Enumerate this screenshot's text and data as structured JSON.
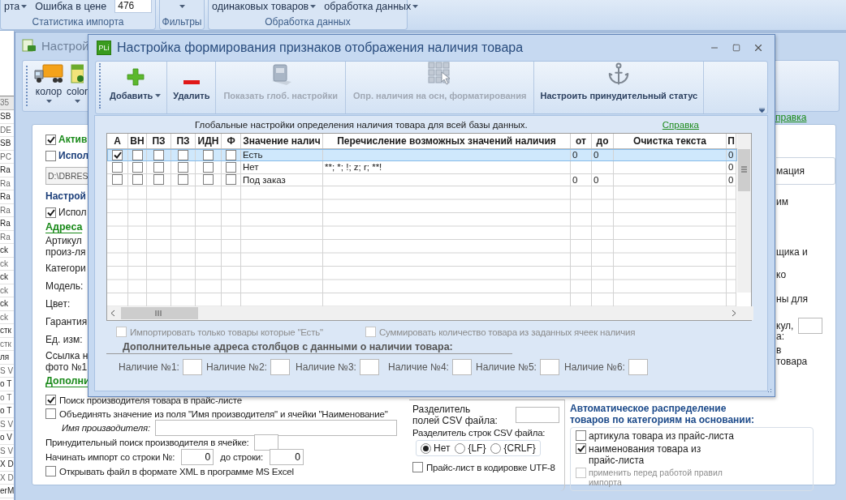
{
  "ribbon": {
    "groups": [
      {
        "caption": "Статистика импорта",
        "items": [
          {
            "kind": "dropdown",
            "label": "рта"
          },
          {
            "kind": "field",
            "label": "Ошибка в цене",
            "value": "476"
          }
        ]
      },
      {
        "caption": "Фильтры",
        "items": [
          {
            "kind": "caret"
          }
        ]
      },
      {
        "caption": "Обработка данных",
        "items": [
          {
            "kind": "dropdown",
            "label": "одинаковых товаров"
          },
          {
            "kind": "dropdown",
            "label": "обработка данных"
          }
        ]
      }
    ]
  },
  "side_list": {
    "header": "35",
    "rows": [
      "SB",
      "DE",
      "SB",
      "PC",
      "Ra",
      "Ra",
      "Ra",
      "Ra",
      "Ra",
      "Ra",
      "ck",
      "ck",
      "ck",
      "ck",
      "ck",
      "ck",
      "стк",
      "стк",
      "ля",
      "S V",
      "o T",
      "o T",
      "o T",
      "S V",
      "o V",
      "S V",
      "X D",
      "X D",
      "erM"
    ]
  },
  "back_window": {
    "title": "Настрой",
    "toolbar": [
      {
        "label": "колор"
      },
      {
        "label": "color"
      }
    ],
    "help_link": "правка",
    "left": [
      {
        "kind": "title-checkbox",
        "label": "Актив",
        "checked": true
      },
      {
        "kind": "group-checkbox",
        "label": "Испол",
        "checked": false
      },
      {
        "kind": "path",
        "value": "D:\\DBRES"
      },
      {
        "kind": "group",
        "label": "Настрой"
      },
      {
        "kind": "checkbox",
        "label": "Испол",
        "checked": true
      },
      {
        "kind": "section",
        "label": "Адреса"
      },
      {
        "kind": "label",
        "lines": [
          "Артикул",
          "произ-ля"
        ]
      },
      {
        "kind": "label",
        "lines": [
          "Категори"
        ]
      },
      {
        "kind": "label",
        "lines": [
          "Модель:"
        ]
      },
      {
        "kind": "label",
        "lines": [
          "Цвет:"
        ]
      },
      {
        "kind": "label",
        "lines": [
          "Гарантия"
        ]
      },
      {
        "kind": "label",
        "lines": [
          "Ед. изм:"
        ]
      },
      {
        "kind": "label",
        "lines": [
          "Ссылка н",
          "фото №1"
        ]
      },
      {
        "kind": "section",
        "label": "Дополни"
      }
    ],
    "right": [
      {
        "kind": "boxed",
        "text": "мация"
      },
      {
        "kind": "label",
        "text": "им"
      },
      {
        "kind": "label",
        "text": "щика и"
      },
      {
        "kind": "label",
        "text": "ко"
      },
      {
        "kind": "label",
        "text": "ны для"
      },
      {
        "kind": "field-label",
        "text": "кул,"
      },
      {
        "kind": "label",
        "text": "а:"
      },
      {
        "kind": "label",
        "text": "в"
      },
      {
        "kind": "label",
        "text": "товара"
      }
    ],
    "options": [
      {
        "kind": "checkbox",
        "label": "Поиск производителя товара в прайс-листе",
        "checked": true
      },
      {
        "kind": "checkbox",
        "label": "Объединять значение из поля \"Имя производителя\" и ячейки \"Наименование\"",
        "checked": false
      },
      {
        "kind": "wide-field",
        "label": "Имя производителя:"
      },
      {
        "kind": "short-field",
        "label": "Принудительный поиск производителя в ячейке:"
      },
      {
        "kind": "range",
        "label": "Начинать импорт со строки №:",
        "value": "0",
        "label_2": "до строки:",
        "value_2": "0"
      },
      {
        "kind": "checkbox",
        "label": "Открывать файл в формате XML в программе MS Excel",
        "checked": false
      }
    ],
    "csv": {
      "field_label": [
        "Разделитель",
        "полей CSV файла:"
      ],
      "rows_label": "Разделитель строк CSV файла:",
      "line_breaks": [
        {
          "label": "Нет",
          "selected": true
        },
        {
          "label": "{LF}",
          "selected": false
        },
        {
          "label": "{CRLF}",
          "selected": false
        }
      ],
      "utf8": {
        "label": "Прайс-лист в кодировке UTF-8",
        "checked": false
      }
    },
    "auto": {
      "title": "Автоматическое распределение товаров по категориям на основании:",
      "options": [
        {
          "lines": [
            "артикула товара из прайс-листа"
          ],
          "checked": false,
          "disabled": false
        },
        {
          "lines": [
            "наименования товара из",
            "прайс-листа"
          ],
          "checked": true,
          "disabled": false
        },
        {
          "lines": [
            "применить перед работой правил",
            "импорта"
          ],
          "checked": false,
          "disabled": true
        }
      ]
    }
  },
  "dialog": {
    "logo": "PLi",
    "title": "Настройка формирования признаков отображения наличия товара",
    "toolbar": [
      {
        "label": "Добавить",
        "dropdown": true,
        "disabled": false
      },
      {
        "label": "Удалить",
        "dropdown": false,
        "disabled": false
      },
      {
        "label": "Показать глоб. настройки",
        "dropdown": false,
        "disabled": true
      },
      {
        "label": "Опр. наличия на осн, форматирования",
        "dropdown": false,
        "disabled": true
      },
      {
        "label": "Настроить принудительный статус",
        "dropdown": false,
        "disabled": false
      }
    ],
    "caption": "Глобальные настройки определения наличия товара для всей базы данных.",
    "help_link": "Справка",
    "table": {
      "columns": [
        "А",
        "ВН",
        "ПЗ",
        "ПЗ",
        "ИДН",
        "Ф",
        "Значение налич",
        "Перечисление возможных значений наличия",
        "от",
        "до",
        "Очистка текста",
        "П"
      ],
      "rows": [
        {
          "selected": true,
          "flags": [
            true,
            false,
            false,
            false,
            false,
            false
          ],
          "value": "Есть",
          "from": "0",
          "to": "0",
          "column_12": "0"
        },
        {
          "selected": false,
          "flags": [
            false,
            false,
            false,
            false,
            false,
            false
          ],
          "value": "Нет",
          "variants": "**; *; !; z; r; **!",
          "column_12": "0"
        },
        {
          "selected": false,
          "flags": [
            false,
            false,
            false,
            false,
            false,
            false
          ],
          "value": "Под заказ",
          "from": "0",
          "to": "0",
          "column_12": "0"
        }
      ]
    },
    "options": [
      {
        "label": "Импортировать только товары которые \"Есть\"",
        "checked": false,
        "disabled": true
      },
      {
        "label": "Суммировать количество товара из заданных ячеек наличия",
        "checked": false,
        "disabled": true
      }
    ],
    "extra_title": "Дополнительные адреса столбцов с данными о наличии товара:",
    "extra_fields": [
      "Наличие №1:",
      "Наличие №2:",
      "Наличие №3:",
      "Наличие №4:",
      "Наличие №5:",
      "Наличие №6:"
    ]
  }
}
